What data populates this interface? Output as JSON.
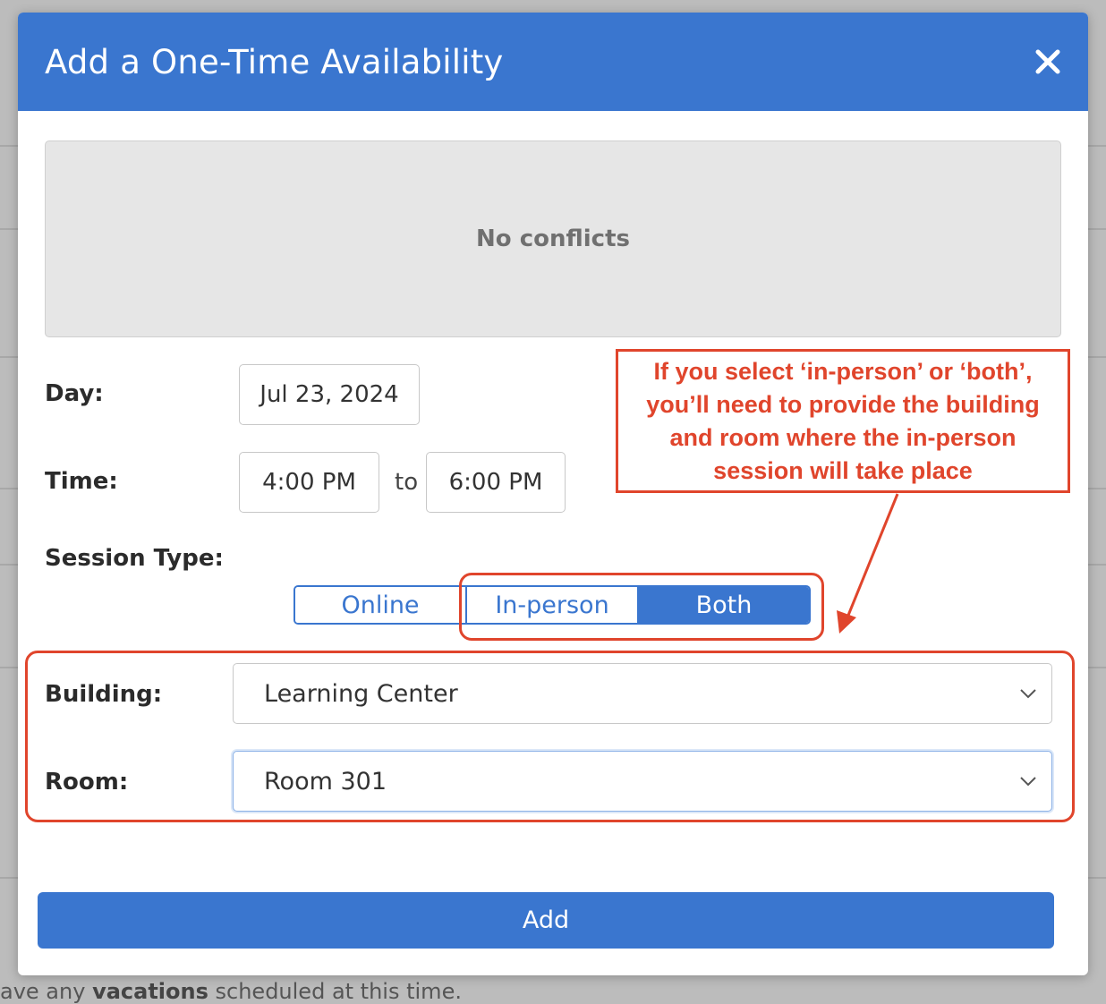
{
  "modal": {
    "title": "Add a One-Time Availability",
    "close_icon": "close-icon",
    "conflicts_text": "No conflicts",
    "day": {
      "label": "Day:",
      "value": "Jul 23, 2024"
    },
    "time": {
      "label": "Time:",
      "start": "4:00 PM",
      "separator": "to",
      "end": "6:00 PM"
    },
    "session_type": {
      "label": "Session Type:",
      "options": [
        "Online",
        "In-person",
        "Both"
      ],
      "selected": "Both"
    },
    "building": {
      "label": "Building:",
      "value": "Learning Center"
    },
    "room": {
      "label": "Room:",
      "value": "Room 301"
    },
    "add_label": "Add"
  },
  "annotation": {
    "callout_text": "If you select ‘in-person’ or ‘both’, you’ll need to provide the building and room where the in-person session will take place",
    "color": "#e0452c"
  },
  "colors": {
    "primary": "#3a76cf",
    "annotation": "#e0452c"
  }
}
